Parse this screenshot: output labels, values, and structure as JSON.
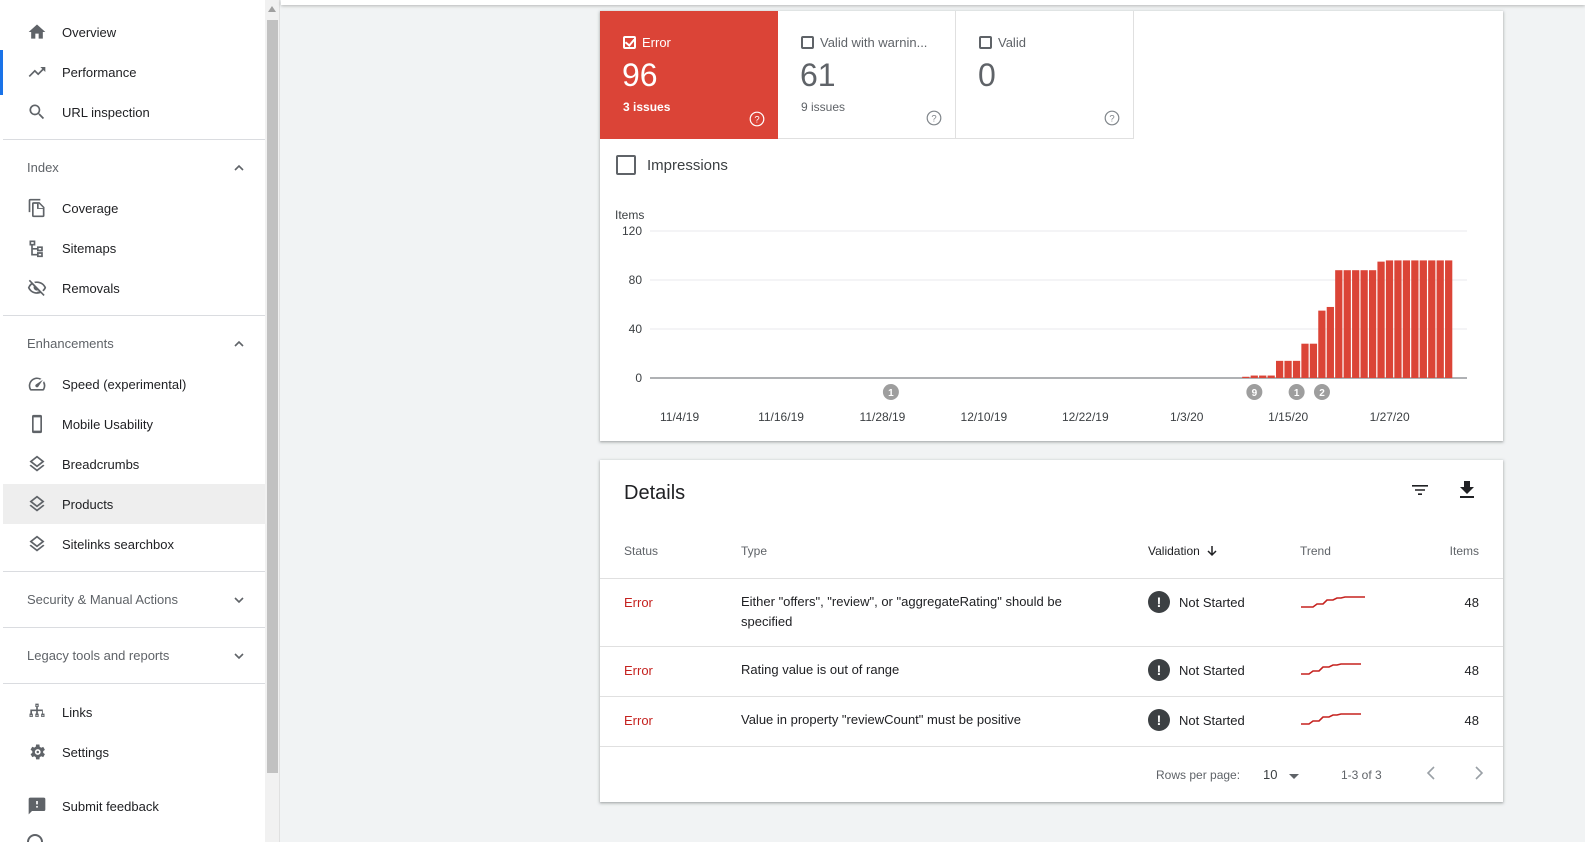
{
  "sidebar": {
    "top_items": [
      {
        "label": "Overview",
        "icon": "home-icon"
      },
      {
        "label": "Performance",
        "icon": "trending-up-icon"
      },
      {
        "label": "URL inspection",
        "icon": "search-icon"
      }
    ],
    "sections": [
      {
        "label": "Index",
        "expanded": true,
        "items": [
          {
            "label": "Coverage",
            "icon": "file-copy-icon"
          },
          {
            "label": "Sitemaps",
            "icon": "sitemap-icon"
          },
          {
            "label": "Removals",
            "icon": "eye-off-icon"
          }
        ]
      },
      {
        "label": "Enhancements",
        "expanded": true,
        "items": [
          {
            "label": "Speed (experimental)",
            "icon": "speedometer-icon"
          },
          {
            "label": "Mobile Usability",
            "icon": "phone-icon"
          },
          {
            "label": "Breadcrumbs",
            "icon": "layers-icon"
          },
          {
            "label": "Products",
            "icon": "layers-icon",
            "active": true
          },
          {
            "label": "Sitelinks searchbox",
            "icon": "layers-icon"
          }
        ]
      },
      {
        "label": "Security & Manual Actions",
        "expanded": false
      },
      {
        "label": "Legacy tools and reports",
        "expanded": false
      }
    ],
    "bottom_items": [
      {
        "label": "Links",
        "icon": "links-icon"
      },
      {
        "label": "Settings",
        "icon": "gear-icon"
      },
      {
        "label": "Submit feedback",
        "icon": "feedback-icon"
      }
    ]
  },
  "summary": {
    "tiles": [
      {
        "label": "Error",
        "value": "96",
        "sub": "3 issues",
        "checked": true,
        "color": "#db4437"
      },
      {
        "label": "Valid with warnin...",
        "value": "61",
        "sub": "9 issues",
        "checked": false
      },
      {
        "label": "Valid",
        "value": "0",
        "sub": "",
        "checked": false
      }
    ],
    "impressions_label": "Impressions"
  },
  "chart_data": {
    "type": "bar",
    "ylabel": "Items",
    "ylim": [
      0,
      120
    ],
    "yticks": [
      0,
      40,
      80,
      120
    ],
    "xtick_labels": [
      "11/4/19",
      "11/16/19",
      "11/28/19",
      "12/10/19",
      "12/22/19",
      "1/3/20",
      "1/15/20",
      "1/27/20"
    ],
    "color": "#db4437",
    "values": [
      0,
      0,
      0,
      0,
      0,
      0,
      0,
      0,
      0,
      0,
      0,
      0,
      0,
      0,
      0,
      0,
      0,
      0,
      0,
      0,
      0,
      0,
      0,
      0,
      0,
      0,
      0,
      0,
      0,
      0,
      0,
      0,
      0,
      0,
      0,
      0,
      0,
      0,
      0,
      0,
      0,
      0,
      0,
      0,
      0,
      0,
      0,
      0,
      0,
      0,
      0,
      0,
      0,
      0,
      0,
      0,
      0,
      0,
      0,
      0,
      0,
      0,
      0,
      0,
      0,
      0,
      0,
      0,
      0,
      0,
      1,
      2,
      2,
      2,
      14,
      14,
      14,
      28,
      28,
      55,
      58,
      88,
      88,
      88,
      88,
      88,
      95,
      96,
      96,
      96,
      96,
      96,
      96,
      96,
      96
    ],
    "annotations": [
      {
        "label": "1",
        "date": "11/29/19"
      },
      {
        "label": "9",
        "date": "1/11/20"
      },
      {
        "label": "1",
        "date": "1/16/20"
      },
      {
        "label": "2",
        "date": "1/19/20"
      }
    ]
  },
  "details": {
    "title": "Details",
    "columns": {
      "status": "Status",
      "type": "Type",
      "validation": "Validation",
      "trend": "Trend",
      "items": "Items"
    },
    "rows": [
      {
        "status": "Error",
        "type": "Either \"offers\", \"review\", or \"aggregateRating\" should be specified",
        "validation": "Not Started",
        "items": "48"
      },
      {
        "status": "Error",
        "type": "Rating value is out of range",
        "validation": "Not Started",
        "items": "48"
      },
      {
        "status": "Error",
        "type": "Value in property \"reviewCount\" must be positive",
        "validation": "Not Started",
        "items": "48"
      }
    ],
    "footer": {
      "rows_per_page_label": "Rows per page:",
      "rows_per_page": "10",
      "range": "1-3 of 3"
    }
  }
}
